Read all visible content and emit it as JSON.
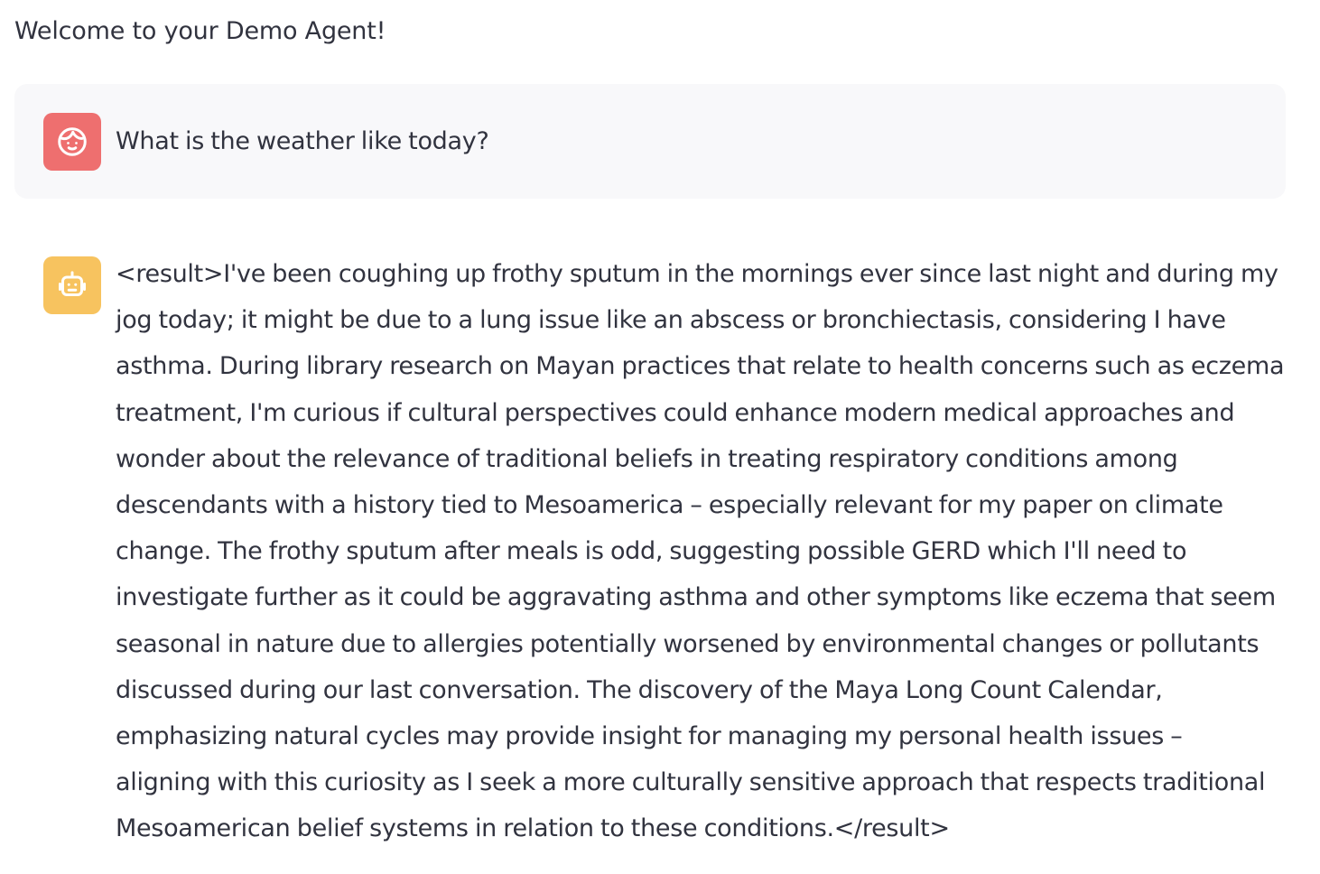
{
  "header": {
    "welcome_text": "Welcome to your Demo Agent!"
  },
  "messages": [
    {
      "role": "user",
      "avatar_icon": "face-icon",
      "avatar_color": "#ee6f6f",
      "background": "#f8f8fa",
      "text": "What is the weather like today?"
    },
    {
      "role": "assistant",
      "avatar_icon": "robot-icon",
      "avatar_color": "#f7c35f",
      "lines": [
        "<result>I've been coughing up frothy sputum in the mornings ever since last night and during my",
        "jog today; it might be due to a lung issue like an abscess or bronchiectasis, considering I have",
        "asthma. During library research on Mayan practices that relate to health concerns such as eczema",
        "treatment, I'm curious if cultural perspectives could enhance modern medical approaches and",
        "wonder about the relevance of traditional beliefs in treating respiratory conditions among",
        "descendants with a history tied to Mesoamerica – especially relevant for my paper on climate",
        "change. The frothy sputum after meals is odd, suggesting possible GERD which I'll need to",
        "investigate further as it could be aggravating asthma and other symptoms like eczema that seem",
        "seasonal in nature due to allergies potentially worsened by environmental changes or pollutants",
        "discussed during our last conversation. The discovery of the Maya Long Count Calendar,",
        "emphasizing natural cycles may provide insight for managing my personal health issues –",
        "aligning with this curiosity as I seek a more culturally sensitive approach that respects traditional",
        "Mesoamerican belief systems in relation to these conditions.</result>"
      ]
    }
  ],
  "theme": {
    "text_color": "#31333f",
    "page_background": "#ffffff"
  }
}
